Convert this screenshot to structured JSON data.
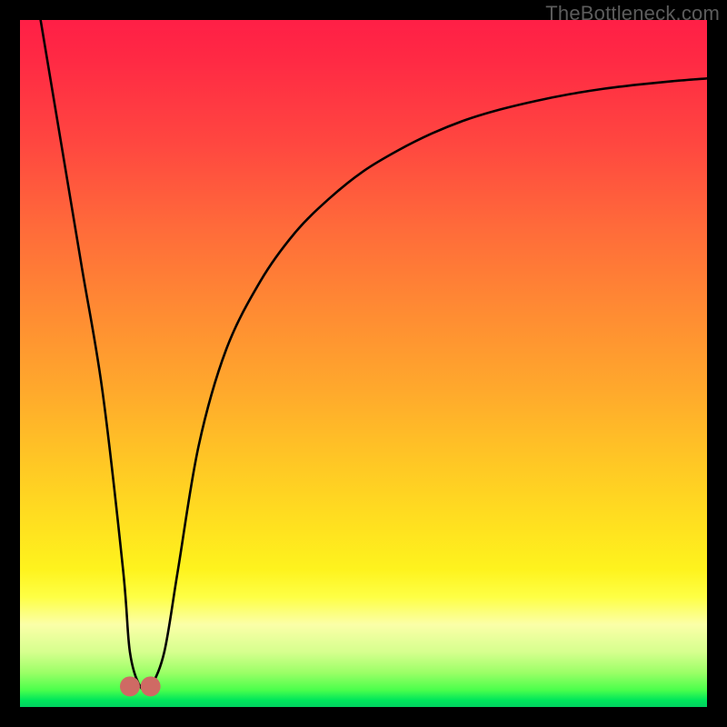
{
  "watermark": "TheBottleneck.com",
  "chart_data": {
    "type": "line",
    "title": "",
    "xlabel": "",
    "ylabel": "",
    "xlim": [
      0,
      100
    ],
    "ylim": [
      0,
      100
    ],
    "grid": false,
    "legend": false,
    "series": [
      {
        "name": "bottleneck-curve",
        "x": [
          3,
          6,
          9,
          12,
          15,
          16,
          17.5,
          19,
          21,
          23,
          26,
          30,
          35,
          40,
          45,
          50,
          55,
          60,
          65,
          70,
          75,
          80,
          85,
          90,
          95,
          100
        ],
        "y": [
          100,
          82,
          64,
          46,
          20,
          8,
          3,
          3,
          8,
          20,
          38,
          52,
          62,
          69,
          74,
          78,
          81,
          83.5,
          85.5,
          87,
          88.2,
          89.2,
          90,
          90.6,
          91.1,
          91.5
        ]
      },
      {
        "name": "marker-left",
        "type": "scatter",
        "x": [
          16
        ],
        "y": [
          3
        ],
        "color": "#cf6a64"
      },
      {
        "name": "marker-right",
        "type": "scatter",
        "x": [
          19
        ],
        "y": [
          3
        ],
        "color": "#cf6a64"
      }
    ],
    "background_gradient": {
      "direction": "vertical",
      "stops": [
        {
          "pos": 0,
          "color": "#ff1f46"
        },
        {
          "pos": 50,
          "color": "#ffa92c"
        },
        {
          "pos": 80,
          "color": "#fef31e"
        },
        {
          "pos": 100,
          "color": "#00d060"
        }
      ]
    }
  }
}
